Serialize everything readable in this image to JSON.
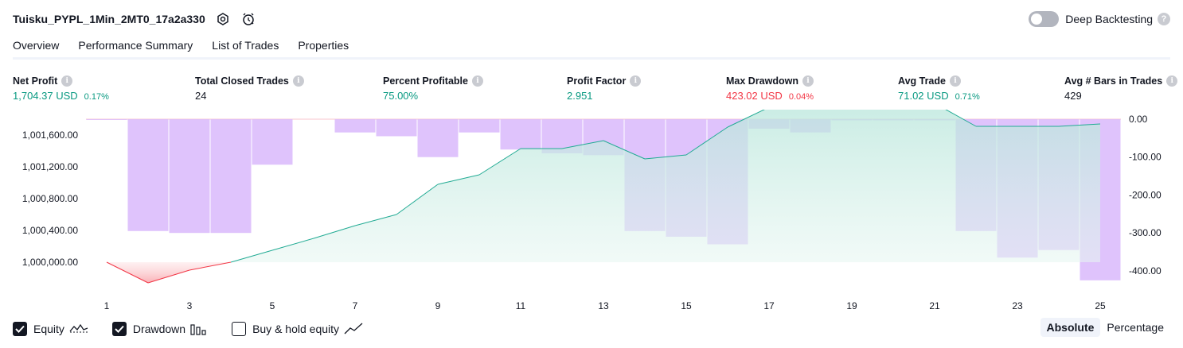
{
  "header": {
    "title": "Tuisku_PYPL_1Min_2MT0_17a2a330",
    "deep_backtesting_label": "Deep Backtesting",
    "deep_backtesting_on": false
  },
  "tabs": [
    {
      "label": "Overview",
      "active": true
    },
    {
      "label": "Performance Summary",
      "active": false
    },
    {
      "label": "List of Trades",
      "active": false
    },
    {
      "label": "Properties",
      "active": false
    }
  ],
  "stats": {
    "net_profit": {
      "label": "Net Profit",
      "value": "1,704.37 USD",
      "pct": "0.17%"
    },
    "total_closed_trades": {
      "label": "Total Closed Trades",
      "value": "24"
    },
    "percent_profitable": {
      "label": "Percent Profitable",
      "value": "75.00%"
    },
    "profit_factor": {
      "label": "Profit Factor",
      "value": "2.951"
    },
    "max_drawdown": {
      "label": "Max Drawdown",
      "value": "423.02 USD",
      "pct": "0.04%"
    },
    "avg_trade": {
      "label": "Avg Trade",
      "value": "71.02 USD",
      "pct": "0.71%"
    },
    "avg_bars": {
      "label": "Avg # Bars in Trades",
      "value": "429"
    }
  },
  "colors": {
    "profit_green": "#089981",
    "loss_red": "#f23645",
    "drawdown_bar": "#d9b8fb",
    "equity_line": "#22ab94",
    "equity_fill": "#b8e6db"
  },
  "chart_data": {
    "type": "line",
    "x": [
      1,
      2,
      3,
      4,
      5,
      6,
      7,
      8,
      9,
      10,
      11,
      12,
      13,
      14,
      15,
      16,
      17,
      18,
      19,
      20,
      21,
      22,
      23,
      24,
      25
    ],
    "x_tick_labels": [
      "1",
      "3",
      "5",
      "7",
      "9",
      "11",
      "13",
      "15",
      "17",
      "19",
      "21",
      "23",
      "25"
    ],
    "left_axis": {
      "ticks": [
        1001600,
        1001200,
        1000800,
        1000400,
        1000000
      ],
      "tick_labels": [
        "1,001,600.00",
        "1,001,200.00",
        "1,000,800.00",
        "1,000,400.00",
        "1,000,000.00"
      ],
      "ylim": [
        999700,
        1001800
      ]
    },
    "right_axis": {
      "ticks": [
        0,
        -100,
        -200,
        -300,
        -400
      ],
      "tick_labels": [
        "0.00",
        "-100.00",
        "-200.00",
        "-300.00",
        "-400.00"
      ],
      "ylim": [
        -440,
        0
      ]
    },
    "series": [
      {
        "name": "Equity",
        "axis": "left",
        "values": [
          1000000,
          999740,
          999900,
          1000000,
          1000150,
          1000300,
          1000460,
          1000600,
          1000980,
          1001100,
          1001430,
          1001430,
          1001530,
          1001300,
          1001350,
          1001700,
          1001950,
          1001970,
          1001980,
          1001990,
          1002000,
          1001710,
          1001710,
          1001710,
          1001740
        ]
      },
      {
        "name": "Drawdown",
        "axis": "right",
        "type": "bar",
        "values": [
          -2,
          -295,
          -300,
          -300,
          -120,
          0,
          -35,
          -45,
          -100,
          -35,
          -80,
          -90,
          -95,
          -295,
          -310,
          -330,
          -25,
          -35,
          -3,
          -3,
          -3,
          -295,
          -365,
          -345,
          -425
        ]
      }
    ]
  },
  "legend": {
    "equity": {
      "label": "Equity",
      "checked": true
    },
    "drawdown": {
      "label": "Drawdown",
      "checked": true
    },
    "buy_hold": {
      "label": "Buy & hold equity",
      "checked": false
    }
  },
  "modes": {
    "absolute": "Absolute",
    "percentage": "Percentage",
    "active": "absolute"
  }
}
